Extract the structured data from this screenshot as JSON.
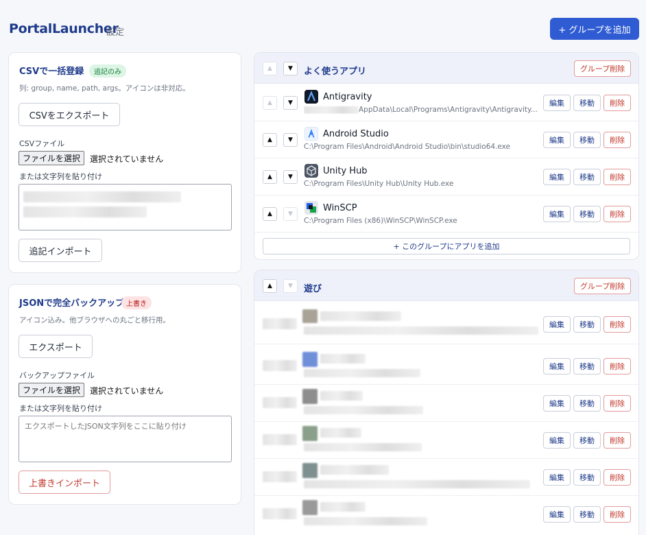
{
  "header": {
    "brand": "PortalLauncher",
    "subtitle": "設定",
    "add_group_label": "+ グループを追加"
  },
  "csv_card": {
    "title": "CSVで一括登録",
    "tag": "追記のみ",
    "description": "列: group, name, path, args。アイコンは非対応。",
    "export_label": "CSVをエクスポート",
    "file_label": "CSVファイル",
    "file_button": "ファイルを選択",
    "file_status": "選択されていません",
    "paste_label": "または文字列を貼り付け",
    "import_label": "追記インポート"
  },
  "json_card": {
    "title": "JSONで完全バックアップ",
    "tag": "上書き",
    "description": "アイコン込み。他ブラウザへの丸ごと移行用。",
    "export_label": "エクスポート",
    "file_label": "バックアップファイル",
    "file_button": "ファイルを選択",
    "file_status": "選択されていません",
    "paste_label": "または文字列を貼り付け",
    "paste_placeholder": "エクスポートしたJSON文字列をここに貼り付け",
    "import_label": "上書きインポート"
  },
  "row_buttons": {
    "edit": "編集",
    "move": "移動",
    "delete": "削除"
  },
  "arrows": {
    "up": "▲",
    "down": "▼"
  },
  "groups": [
    {
      "name": "よく使うアプリ",
      "delete_label": "グループ削除",
      "add_app_label": "+ このグループにアプリを追加",
      "apps": [
        {
          "name": "Antigravity",
          "path": "AppData\\Local\\Programs\\Antigravity\\Antigravity....",
          "icon": "antigravity-icon"
        },
        {
          "name": "Android Studio",
          "path": "C:\\Program Files\\Android\\Android Studio\\bin\\studio64.exe",
          "icon": "android-studio-icon"
        },
        {
          "name": "Unity Hub",
          "path": "C:\\Program Files\\Unity Hub\\Unity Hub.exe",
          "icon": "unity-hub-icon"
        },
        {
          "name": "WinSCP",
          "path": "C:\\Program Files (x86)\\WinSCP\\WinSCP.exe",
          "icon": "winscp-icon"
        }
      ]
    },
    {
      "name": "遊び",
      "delete_label": "グループ削除"
    }
  ],
  "colors": {
    "accent": "#2f5bd3",
    "brand": "#1e3a8a",
    "danger": "#c0392b"
  }
}
